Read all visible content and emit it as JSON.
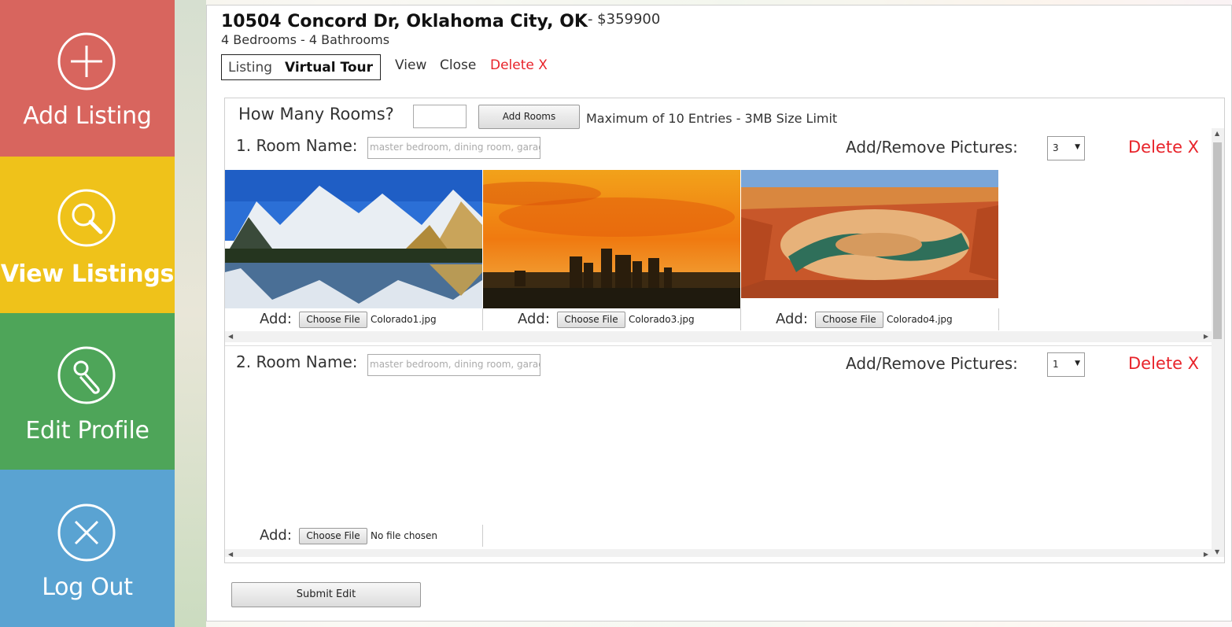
{
  "sidebar": {
    "items": [
      {
        "label": "Add Listing",
        "icon": "plus-circle-icon"
      },
      {
        "label": "View Listings",
        "icon": "magnifier-icon"
      },
      {
        "label": "Edit Profile",
        "icon": "wrench-icon"
      },
      {
        "label": "Log Out",
        "icon": "x-circle-icon"
      }
    ]
  },
  "listing": {
    "address": "10504 Concord Dr, Oklahoma City, OK",
    "price": "- $359900",
    "details": "4 Bedrooms - 4 Bathrooms"
  },
  "tabs": {
    "listing": "Listing",
    "virtual_tour": "Virtual Tour"
  },
  "actions": {
    "view": "View",
    "close": "Close",
    "delete": "Delete X"
  },
  "editor": {
    "how_many_label": "How Many Rooms?",
    "how_many_value": "",
    "add_rooms_button": "Add Rooms",
    "max_note": "Maximum of 10 Entries - 3MB Size Limit",
    "rooms": [
      {
        "label": "1. Room Name:",
        "placeholder": "master bedroom, dining room, garage",
        "pictures_label": "Add/Remove Pictures:",
        "pictures_count": "3",
        "delete": "Delete X",
        "files": [
          {
            "add": "Add:",
            "button": "Choose File",
            "name": "Colorado1.jpg"
          },
          {
            "add": "Add:",
            "button": "Choose File",
            "name": "Colorado3.jpg"
          },
          {
            "add": "Add:",
            "button": "Choose File",
            "name": "Colorado4.jpg"
          }
        ]
      },
      {
        "label": "2. Room Name:",
        "placeholder": "master bedroom, dining room, garage",
        "pictures_label": "Add/Remove Pictures:",
        "pictures_count": "1",
        "delete": "Delete X",
        "files": [
          {
            "add": "Add:",
            "button": "Choose File",
            "name": "No file chosen"
          }
        ]
      }
    ]
  },
  "submit_button": "Submit Edit",
  "colors": {
    "add_listing": "#d8655e",
    "view_listings": "#efc21a",
    "edit_profile": "#4ea559",
    "log_out": "#5aa3d2",
    "delete_red": "#e8232a"
  }
}
